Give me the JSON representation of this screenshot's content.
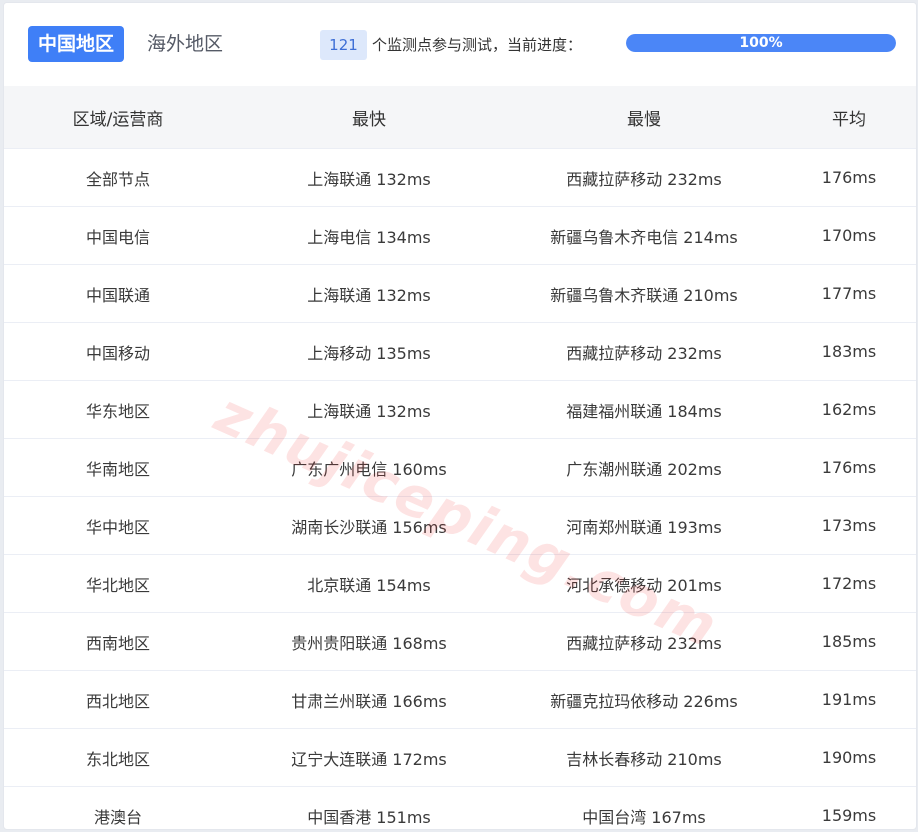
{
  "tabs": [
    {
      "label": "中国地区",
      "active": true
    },
    {
      "label": "海外地区",
      "active": false
    }
  ],
  "monitor": {
    "count": "121",
    "text": "个监测点参与测试，当前进度：",
    "progress_label": "100%",
    "progress_fraction": 1.0
  },
  "table": {
    "headers": [
      "区域/运营商",
      "最快",
      "最慢",
      "平均"
    ],
    "rows": [
      [
        "全部节点",
        "上海联通 132ms",
        "西藏拉萨移动 232ms",
        "176ms"
      ],
      [
        "中国电信",
        "上海电信 134ms",
        "新疆乌鲁木齐电信 214ms",
        "170ms"
      ],
      [
        "中国联通",
        "上海联通 132ms",
        "新疆乌鲁木齐联通 210ms",
        "177ms"
      ],
      [
        "中国移动",
        "上海移动 135ms",
        "西藏拉萨移动 232ms",
        "183ms"
      ],
      [
        "华东地区",
        "上海联通 132ms",
        "福建福州联通 184ms",
        "162ms"
      ],
      [
        "华南地区",
        "广东广州电信 160ms",
        "广东潮州联通 202ms",
        "176ms"
      ],
      [
        "华中地区",
        "湖南长沙联通 156ms",
        "河南郑州联通 193ms",
        "173ms"
      ],
      [
        "华北地区",
        "北京联通 154ms",
        "河北承德移动 201ms",
        "172ms"
      ],
      [
        "西南地区",
        "贵州贵阳联通 168ms",
        "西藏拉萨移动 232ms",
        "185ms"
      ],
      [
        "西北地区",
        "甘肃兰州联通 166ms",
        "新疆克拉玛依移动 226ms",
        "191ms"
      ],
      [
        "东北地区",
        "辽宁大连联通 172ms",
        "吉林长春移动 210ms",
        "190ms"
      ],
      [
        "港澳台",
        "中国香港 151ms",
        "中国台湾 167ms",
        "159ms"
      ]
    ]
  },
  "watermark": "zhujiceping.com",
  "colors": {
    "accent": "#3f7ff7",
    "progress": "#4b86f7",
    "badge_bg": "#dde8fb",
    "header_bg": "#f5f6f8"
  }
}
